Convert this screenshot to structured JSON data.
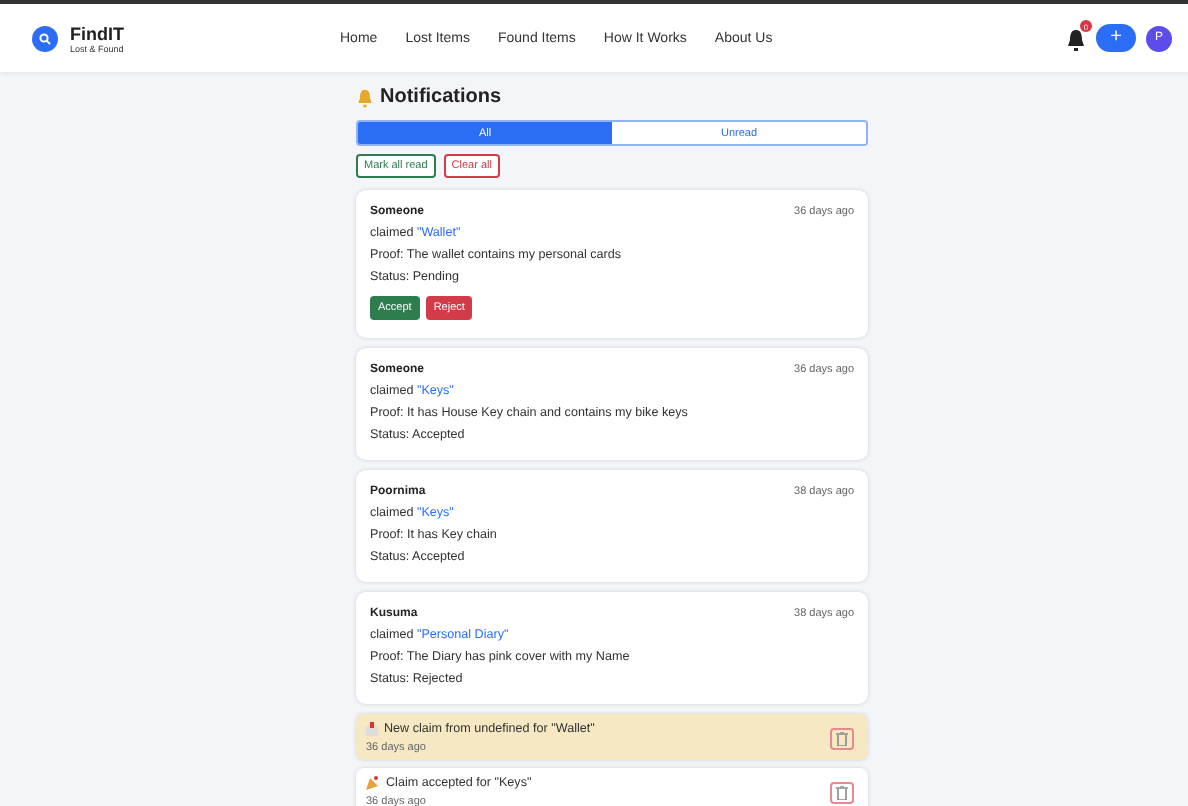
{
  "brand": {
    "name": "FindIT",
    "tagline": "Lost & Found"
  },
  "nav": [
    {
      "label": "Home"
    },
    {
      "label": "Lost Items"
    },
    {
      "label": "Found Items"
    },
    {
      "label": "How It Works"
    },
    {
      "label": "About Us"
    }
  ],
  "header_actions": {
    "badge": "0",
    "add_label": "+",
    "avatar": "P"
  },
  "page_title": "Notifications",
  "tabs": [
    {
      "label": "All",
      "selected": true
    },
    {
      "label": "Unread",
      "selected": false
    }
  ],
  "actions": [
    {
      "label": "Mark all read",
      "kind": "success"
    },
    {
      "label": "Clear all",
      "kind": "danger"
    }
  ],
  "claims": [
    {
      "name": "Someone",
      "verb": "claimed",
      "item": "\"Wallet\"",
      "time": "36 days ago",
      "proof": "Proof: The wallet contains my personal cards",
      "status": "Status: Pending",
      "buttons": [
        {
          "label": "Accept",
          "kind": "success"
        },
        {
          "label": "Reject",
          "kind": "danger"
        }
      ]
    },
    {
      "name": "Someone",
      "verb": "claimed",
      "item": "\"Keys\"",
      "time": "36 days ago",
      "proof": "Proof: It has House Key chain and contains my bike keys",
      "status": "Status: Accepted"
    },
    {
      "name": "Poornima",
      "verb": "claimed",
      "item": "\"Keys\"",
      "time": "38 days ago",
      "proof": "Proof: It has Key chain",
      "status": "Status: Accepted"
    },
    {
      "name": "Kusuma",
      "verb": "claimed",
      "item": "\"Personal Diary\"",
      "time": "38 days ago",
      "proof": "Proof: The Diary has pink cover with my Name",
      "status": "Status: Rejected"
    }
  ],
  "notifications": [
    {
      "kind": "mail",
      "message": "New claim from undefined for \"Wallet\"",
      "time": "36 days ago",
      "read": false
    },
    {
      "kind": "party",
      "message": "Claim accepted for \"Keys\"",
      "time": "36 days ago",
      "read": true
    }
  ]
}
